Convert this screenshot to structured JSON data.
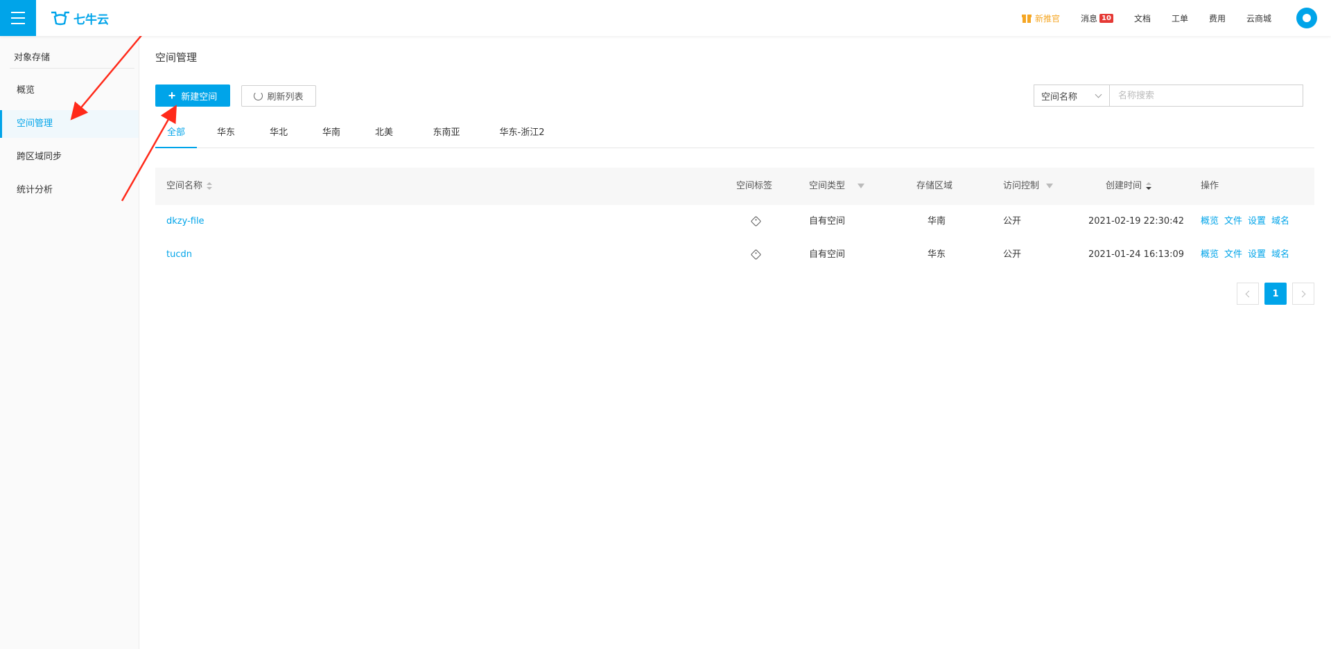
{
  "topbar": {
    "logo_text": "七牛云",
    "nav": {
      "new_user": "新推官",
      "messages": "消息",
      "message_count": "10",
      "docs": "文档",
      "tickets": "工单",
      "billing": "费用",
      "marketplace": "云商城"
    }
  },
  "sidebar": {
    "title": "对象存储",
    "items": [
      {
        "label": "概览"
      },
      {
        "label": "空间管理"
      },
      {
        "label": "跨区域同步"
      },
      {
        "label": "统计分析"
      }
    ]
  },
  "main": {
    "page_title": "空间管理",
    "new_bucket_label": "新建空间",
    "refresh_label": "刷新列表",
    "search": {
      "field_selected": "空间名称",
      "placeholder": "名称搜索"
    },
    "tabs": [
      "全部",
      "华东",
      "华北",
      "华南",
      "北美",
      "东南亚",
      "华东-浙江2"
    ],
    "table": {
      "headers": {
        "name": "空间名称",
        "tags": "空间标签",
        "type": "空间类型",
        "region": "存储区域",
        "access": "访问控制",
        "created": "创建时间",
        "ops": "操作"
      },
      "rows": [
        {
          "name": "dkzy-file",
          "type": "自有空间",
          "region": "华南",
          "access": "公开",
          "created": "2021-02-19 22:30:42"
        },
        {
          "name": "tucdn",
          "type": "自有空间",
          "region": "华东",
          "access": "公开",
          "created": "2021-01-24 16:13:09"
        }
      ],
      "ops": [
        "概览",
        "文件",
        "设置",
        "域名"
      ]
    },
    "pagination": {
      "current_page": "1"
    }
  },
  "colors": {
    "accent": "#00a4e9",
    "highlight_orange": "#f5a623",
    "badge_red": "#e53935",
    "annotation_red": "#ff2a1a"
  }
}
